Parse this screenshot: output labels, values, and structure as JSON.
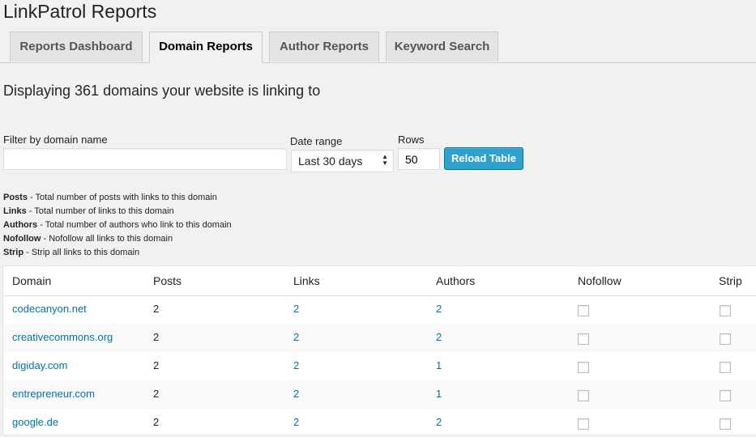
{
  "page_title": "LinkPatrol Reports",
  "tabs": [
    {
      "label": "Reports Dashboard",
      "active": false
    },
    {
      "label": "Domain Reports",
      "active": true
    },
    {
      "label": "Author Reports",
      "active": false
    },
    {
      "label": "Keyword Search",
      "active": false
    }
  ],
  "summary": "Displaying 361 domains your website is linking to",
  "filters": {
    "domain_label": "Filter by domain name",
    "domain_value": "",
    "date_label": "Date range",
    "date_value": "Last 30 days",
    "rows_label": "Rows",
    "rows_value": "50",
    "reload_label": "Reload Table"
  },
  "legend": [
    {
      "term": "Posts",
      "desc": " - Total number of posts with links to this domain"
    },
    {
      "term": "Links",
      "desc": " - Total number of links to this domain"
    },
    {
      "term": "Authors",
      "desc": " - Total number of authors who link to this domain"
    },
    {
      "term": "Nofollow",
      "desc": " - Nofollow all links to this domain"
    },
    {
      "term": "Strip",
      "desc": " - Strip all links to this domain"
    }
  ],
  "table": {
    "headers": [
      "Domain",
      "Posts",
      "Links",
      "Authors",
      "Nofollow",
      "Strip"
    ],
    "rows": [
      {
        "domain": "codecanyon.net",
        "posts": "2",
        "links": "2",
        "authors": "2",
        "nofollow": false,
        "strip": false
      },
      {
        "domain": "creativecommons.org",
        "posts": "2",
        "links": "2",
        "authors": "2",
        "nofollow": false,
        "strip": false
      },
      {
        "domain": "digiday.com",
        "posts": "2",
        "links": "2",
        "authors": "1",
        "nofollow": false,
        "strip": false
      },
      {
        "domain": "entrepreneur.com",
        "posts": "2",
        "links": "2",
        "authors": "1",
        "nofollow": false,
        "strip": false
      },
      {
        "domain": "google.de",
        "posts": "2",
        "links": "2",
        "authors": "2",
        "nofollow": false,
        "strip": false
      }
    ]
  },
  "colors": {
    "link": "#0074a2",
    "button": "#2ea2cc",
    "background": "#f1f1f1"
  }
}
